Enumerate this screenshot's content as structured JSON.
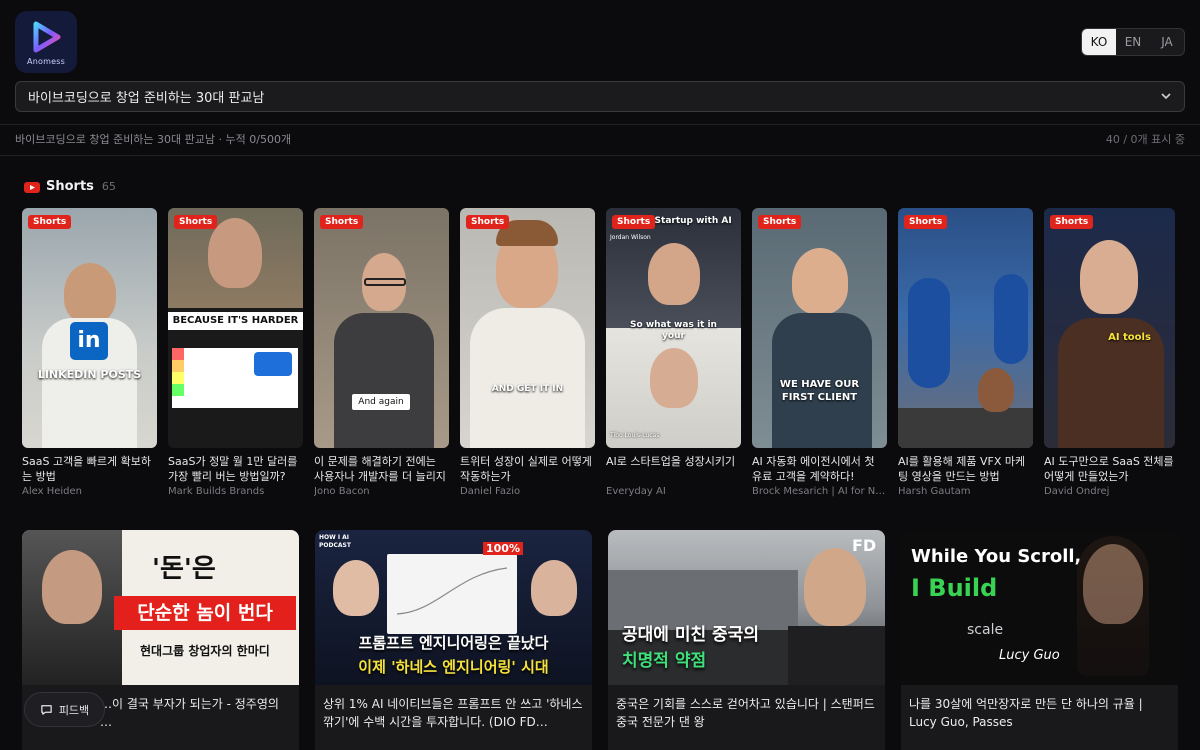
{
  "brand": {
    "logo_text": "Anomess"
  },
  "lang": [
    "KO",
    "EN",
    "JA"
  ],
  "selector": {
    "value": "바이브코딩으로 창업 준비하는 30대 판교남"
  },
  "summary": {
    "text": "바이브코딩으로 창업 준비하는 30대 판교남 · 누적 0/500개",
    "count": "40 / 0개 표시 중"
  },
  "shorts_section": {
    "title": "Shorts",
    "count": "65",
    "badge": "Shorts"
  },
  "shorts": [
    {
      "title": "SaaS 고객을 빠르게 확보하는 방법",
      "channel": "Alex Heiden",
      "overlay": "LINKEDIN POSTS"
    },
    {
      "title": "SaaS가 정말 월 1만 달러를 가장 빨리 버는 방법일까?",
      "channel": "Mark Builds Brands",
      "overlay": "BECAUSE IT'S HARDER"
    },
    {
      "title": "이 문제를 해결하기 전에는 사용자나 개발자를 더 늘리지 …",
      "channel": "Jono Bacon",
      "overlay": "And again"
    },
    {
      "title": "트위터 성장이 실제로 어떻게 작동하는가",
      "channel": "Daniel Fazio",
      "overlay": "AND GET IT IN"
    },
    {
      "title": "AI로 스타트업을 성장시키기",
      "channel": "Everyday AI",
      "overlay": "So what was it in your",
      "top_text": "a Startup with AI",
      "name_tag": "Jordan Wilson",
      "name_tag2": "Tibo Louis-Lucas"
    },
    {
      "title": "AI 자동화 에이전시에서 첫 유료 고객을 계약하다!",
      "channel": "Brock Mesarich | AI for No…",
      "overlay": "WE HAVE OUR FIRST CLIENT"
    },
    {
      "title": "AI를 활용해 제품 VFX 마케팅 영상을 만드는 방법",
      "channel": "Harsh Gautam",
      "overlay": ""
    },
    {
      "title": "AI 도구만으로 SaaS 전체를 어떻게 만들었는가",
      "channel": "David Ondrej",
      "overlay": "AI tools"
    }
  ],
  "videos": [
    {
      "title": "…이 결국 부자가 되는가 - 정주영의 …",
      "thumb_line1": "'돈'은",
      "thumb_line2": "단순한 놈이 번다",
      "thumb_line3": "현대그룹 창업자의 한마디"
    },
    {
      "title": "상위 1% AI 네이티브들은 프롬프트 안 쓰고 '하네스 깎기'에 수백 시간을 투자합니다. (DIO FD…",
      "thumb_line1": "프롬프트 엔지니어링은 끝났다",
      "thumb_line2": "이제 '하네스 엔지니어링' 시대",
      "thumb_line3": "HOW I AI PODCAST",
      "thumb_line4": "100%"
    },
    {
      "title": "중국은 기회를 스스로 걷어차고 있습니다 | 스탠퍼드 중국 전문가 댄 왕",
      "thumb_line1": "공대에 미친 중국의",
      "thumb_line2": "치명적 약점",
      "thumb_line3": "FD"
    },
    {
      "title": "나를 30살에 억만장자로 만든 단 하나의 규율 | Lucy Guo, Passes",
      "thumb_line1": "While You Scroll,",
      "thumb_line2": "I Build",
      "thumb_line3": "scale",
      "thumb_line4": "Lucy Guo"
    }
  ],
  "feedback": {
    "label": "피드백"
  },
  "colors": {
    "badge": "#e0241b",
    "background": "#0b0b0d",
    "accent_green": "#39d353"
  }
}
